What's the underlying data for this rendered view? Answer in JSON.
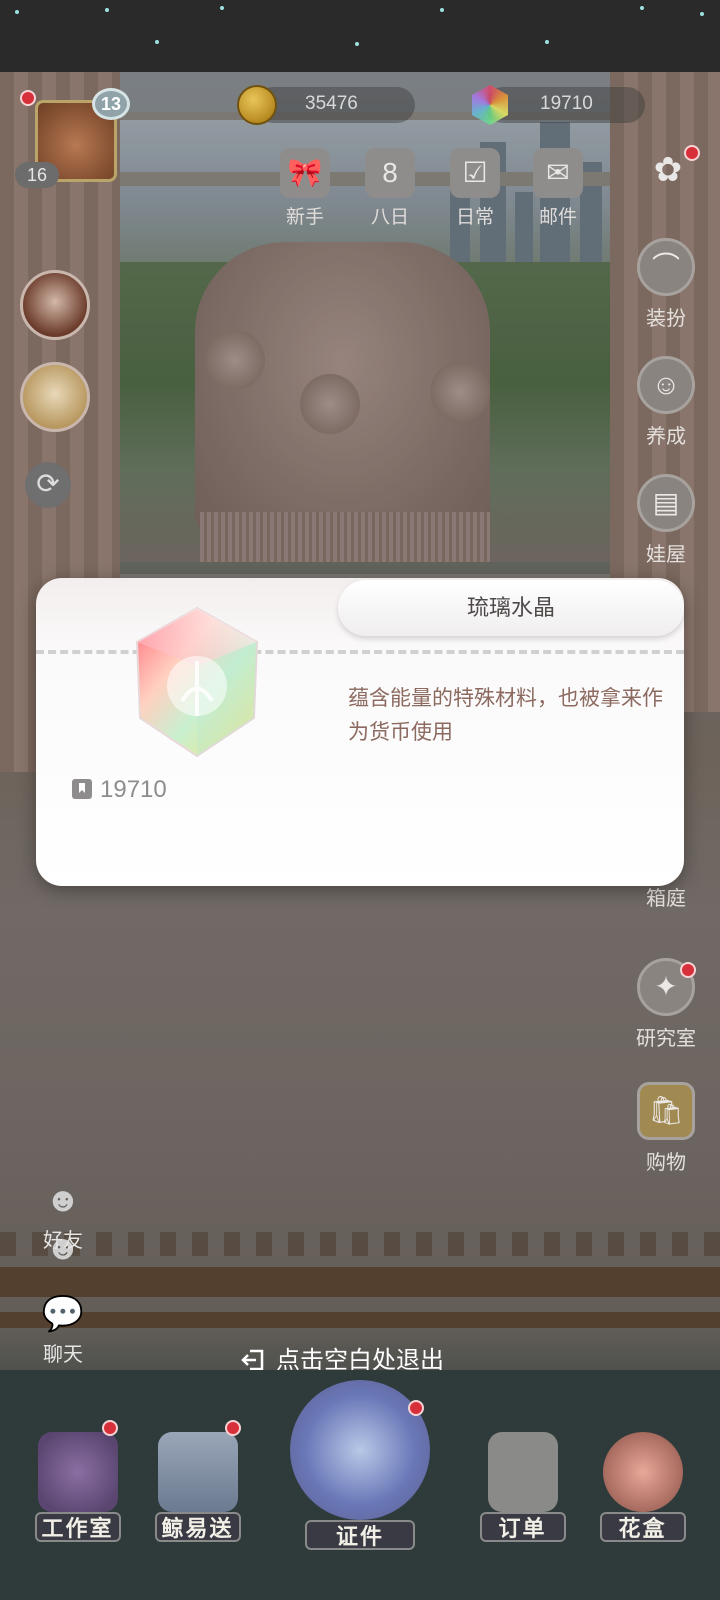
{
  "currency": {
    "coins": "35476",
    "crystals": "19710"
  },
  "player": {
    "level": "13",
    "vip_level": "16"
  },
  "top_menu": [
    {
      "label": "新手",
      "icon": "gift-bow-icon"
    },
    {
      "label": "八日",
      "icon": "eight-day-icon"
    },
    {
      "label": "日常",
      "icon": "clipboard-icon"
    },
    {
      "label": "邮件",
      "icon": "mail-icon"
    }
  ],
  "right_menu": [
    {
      "label": "装扮",
      "icon": "hanger-icon"
    },
    {
      "label": "养成",
      "icon": "doll-icon"
    },
    {
      "label": "娃屋",
      "icon": "cabinet-icon"
    },
    {
      "label": "箱庭",
      "icon": "garden-icon"
    },
    {
      "label": "研究室",
      "icon": "research-book-icon"
    },
    {
      "label": "购物",
      "icon": "shopping-bag-icon"
    }
  ],
  "left_social": [
    {
      "label": "好友",
      "icon": "friends-icon"
    },
    {
      "label": "聊天",
      "icon": "chat-bubble-icon"
    }
  ],
  "bottom_nav": [
    {
      "label": "工作室",
      "icon": "studio-icon"
    },
    {
      "label": "鲸易送",
      "icon": "shop-stall-icon"
    },
    {
      "label": "证件",
      "icon": "certificate-icon"
    },
    {
      "label": "订单",
      "icon": "order-paper-icon"
    },
    {
      "label": "花盒",
      "icon": "flower-box-icon"
    }
  ],
  "popup": {
    "title": "琉璃水晶",
    "owned_count": "19710",
    "description": "蕴含能量的特殊材料，也被拿来作为货币使用",
    "item_icon": "crystal-icon"
  },
  "exit_hint": "点击空白处退出",
  "colors": {
    "popup_bg": "#ffffff",
    "description_text": "#8c6a60",
    "notification_dot": "#d8303a"
  }
}
